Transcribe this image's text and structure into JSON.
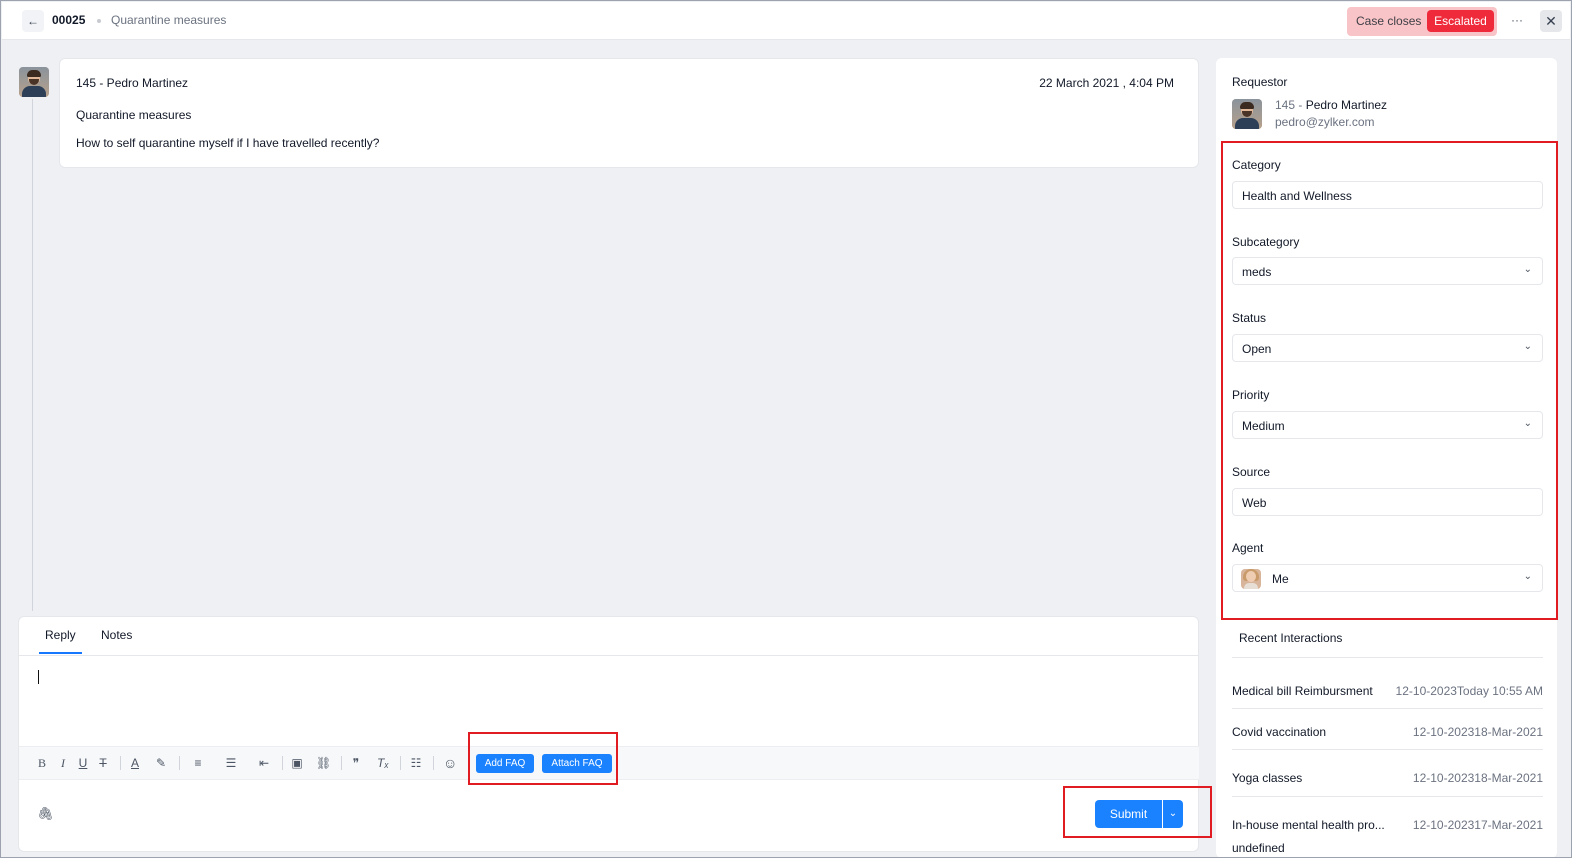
{
  "header": {
    "back_icon": "←",
    "case_id": "00025",
    "case_title": "Quarantine measures",
    "sla_label": "Case closes",
    "sla_status": "Escalated",
    "more_icon": "···",
    "close_icon": "✕",
    "colors": {
      "sla_bg": "#f8c4c7",
      "badge": "#ef2b3b"
    }
  },
  "message": {
    "from": "145 - Pedro Martinez",
    "date": "22 March 2021 , 4:04 PM",
    "subject": "Quarantine measures",
    "body": "How to self quarantine myself if I have travelled recently?"
  },
  "reply": {
    "tabs": [
      "Reply",
      "Notes"
    ],
    "active_tab": "Reply",
    "toolbar": {
      "bold": "B",
      "italic": "I",
      "underline": "U",
      "strike": "T",
      "font_color": "A",
      "highlight": "✎",
      "align": "≡",
      "list": "☰",
      "indent": "⇤",
      "image": "▣",
      "link": "⛓",
      "quote": "❞",
      "clear_format": "Tₓ",
      "divider": "☷",
      "emoji": "☺"
    },
    "add_faq": "Add FAQ",
    "attach_faq": "Attach FAQ",
    "attach_icon": "🖇",
    "submit": "Submit",
    "submit_dropdown_icon": "⌄"
  },
  "panel": {
    "requestor_label": "Requestor",
    "requestor_id": "145 - ",
    "requestor_name": "Pedro Martinez",
    "requestor_email": "pedro@zylker.com",
    "fields": {
      "category_label": "Category",
      "category_value": "Health and Wellness",
      "subcategory_label": "Subcategory",
      "subcategory_value": "meds",
      "status_label": "Status",
      "status_value": "Open",
      "priority_label": "Priority",
      "priority_value": "Medium",
      "source_label": "Source",
      "source_value": "Web",
      "agent_label": "Agent",
      "agent_value": "Me"
    },
    "chevron": "⌄",
    "recent_title": "Recent Interactions",
    "recent": [
      {
        "name": "Medical bill Reimbursment",
        "date": "12-10-2023Today 10:55 AM"
      },
      {
        "name": "Covid vaccination",
        "date": "12-10-202318-Mar-2021"
      },
      {
        "name": "Yoga classes",
        "date": "12-10-202318-Mar-2021"
      },
      {
        "name": "In-house mental health pro...",
        "date": "12-10-202317-Mar-2021"
      }
    ],
    "trailing": "undefined"
  }
}
